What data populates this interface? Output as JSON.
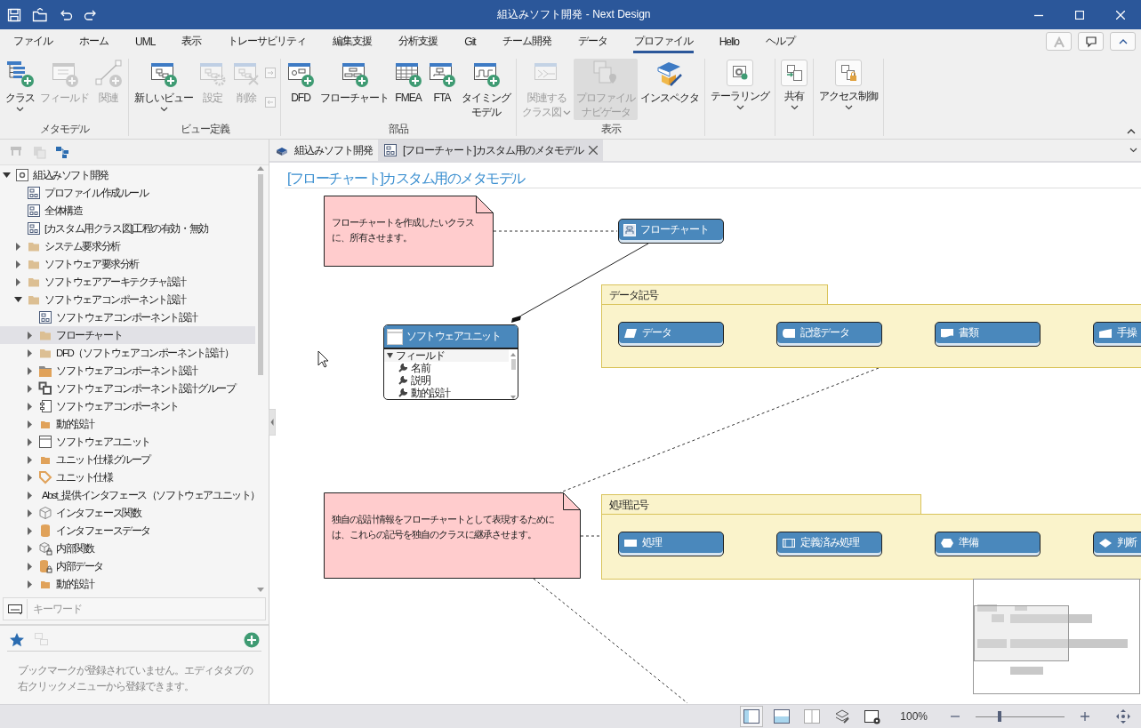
{
  "window": {
    "title": "組込みソフト開発 - Next Design"
  },
  "menu_tabs": [
    {
      "label": "ファイル",
      "selected": false
    },
    {
      "label": "ホーム",
      "selected": false
    },
    {
      "label": "UML",
      "selected": false
    },
    {
      "label": "表示",
      "selected": false
    },
    {
      "label": "トレーサビリティ",
      "selected": false
    },
    {
      "label": "編集支援",
      "selected": false
    },
    {
      "label": "分析支援",
      "selected": false
    },
    {
      "label": "Git",
      "selected": false
    },
    {
      "label": "チーム開発",
      "selected": false
    },
    {
      "label": "データ",
      "selected": false
    },
    {
      "label": "プロファイル",
      "selected": true
    },
    {
      "label": "Hello",
      "selected": false
    },
    {
      "label": "ヘルプ",
      "selected": false
    }
  ],
  "ribbon": {
    "groups": [
      {
        "label": "メタモデル",
        "items": [
          {
            "kind": "large",
            "lines": [
              "クラス"
            ],
            "disabled": false,
            "dropdown": true
          },
          {
            "kind": "large",
            "lines": [
              "フィールド"
            ],
            "disabled": true,
            "dropdown": false
          },
          {
            "kind": "large",
            "lines": [
              "関連"
            ],
            "disabled": true,
            "dropdown": false
          }
        ]
      },
      {
        "label": "ビュー定義",
        "items": [
          {
            "kind": "large",
            "lines": [
              "新しいビュー"
            ],
            "disabled": false,
            "dropdown": true
          },
          {
            "kind": "large",
            "lines": [
              "設定"
            ],
            "disabled": true,
            "dropdown": false
          },
          {
            "kind": "large",
            "lines": [
              "削除"
            ],
            "disabled": true,
            "dropdown": false
          },
          {
            "kind": "small",
            "disabled": true
          },
          {
            "kind": "small",
            "disabled": true
          }
        ]
      },
      {
        "label": "部品",
        "items": [
          {
            "kind": "large",
            "lines": [
              "DFD"
            ],
            "disabled": false,
            "dropdown": false
          },
          {
            "kind": "large",
            "lines": [
              "フローチャート"
            ],
            "disabled": false,
            "dropdown": false
          },
          {
            "kind": "large",
            "lines": [
              "FMEA"
            ],
            "disabled": false,
            "dropdown": false
          },
          {
            "kind": "large",
            "lines": [
              "FTA"
            ],
            "disabled": false,
            "dropdown": false
          },
          {
            "kind": "large",
            "lines": [
              "タイミング",
              "モデル"
            ],
            "disabled": false,
            "dropdown": false
          }
        ]
      },
      {
        "label": "表示",
        "items": [
          {
            "kind": "large",
            "lines": [
              "関連する",
              "クラス図"
            ],
            "disabled": true,
            "dropdown": true,
            "pressed": false
          },
          {
            "kind": "large",
            "lines": [
              "プロファイル",
              "ナビゲータ"
            ],
            "disabled": true,
            "dropdown": false,
            "pressed": true
          },
          {
            "kind": "large",
            "lines": [
              "インスペクタ"
            ],
            "disabled": false,
            "dropdown": false,
            "pressed": false
          }
        ]
      },
      {
        "items": [
          {
            "kind": "boxed",
            "lines": [
              "テーラリング"
            ],
            "disabled": false,
            "dropdown": true
          }
        ]
      },
      {
        "items": [
          {
            "kind": "boxed",
            "lines": [
              "共有"
            ],
            "disabled": false,
            "dropdown": true
          }
        ]
      },
      {
        "items": [
          {
            "kind": "boxed",
            "lines": [
              "アクセス制御"
            ],
            "disabled": false,
            "dropdown": true
          }
        ]
      }
    ]
  },
  "tree_toolbar": [
    {
      "disabled": true
    },
    {
      "disabled": true
    },
    {
      "disabled": false
    }
  ],
  "tree": [
    {
      "kind": "project",
      "label": "組込みソフト開発",
      "expanded": true,
      "selected": false,
      "children": [
        {
          "kind": "diagram",
          "label": "プロファイル作成ルール",
          "selected": false
        },
        {
          "kind": "diagram",
          "label": "全体構造",
          "selected": false
        },
        {
          "kind": "diagram",
          "label": "[カスタム用クラス図]工程の有効・無効",
          "selected": false
        },
        {
          "kind": "package",
          "label": "システム要求分析",
          "expanded": false,
          "selected": false
        },
        {
          "kind": "package",
          "label": "ソフトウェア要求分析",
          "expanded": false,
          "selected": false
        },
        {
          "kind": "package",
          "label": "ソフトウェアアーキテクチャ設計",
          "expanded": false,
          "selected": false
        },
        {
          "kind": "package",
          "label": "ソフトウェアコンポーネント設計",
          "expanded": true,
          "selected": false,
          "children": [
            {
              "kind": "diagram",
              "label": "ソフトウェアコンポーネント設計",
              "selected": false
            },
            {
              "kind": "package",
              "label": "フローチャート",
              "expanded": false,
              "selected": true
            },
            {
              "kind": "package",
              "label": "DFD（ソフトウェアコンポーネント設計）",
              "expanded": false,
              "selected": false
            },
            {
              "kind": "bigfolder",
              "label": "ソフトウェアコンポーネント設計",
              "expanded": false,
              "selected": false
            },
            {
              "kind": "group",
              "label": "ソフトウェアコンポーネント設計グループ",
              "expanded": false,
              "selected": false
            },
            {
              "kind": "component",
              "label": "ソフトウェアコンポーネント",
              "expanded": false,
              "selected": false
            },
            {
              "kind": "folder",
              "label": "動的設計",
              "expanded": false,
              "selected": false
            },
            {
              "kind": "unit",
              "label": "ソフトウェアユニット",
              "expanded": false,
              "selected": false
            },
            {
              "kind": "folder",
              "label": "ユニット仕様グループ",
              "expanded": false,
              "selected": false
            },
            {
              "kind": "tag",
              "label": "ユニット仕様",
              "expanded": false,
              "selected": false
            },
            {
              "kind": "interface",
              "label": "Abst_提供インタフェース（ソフトウェアユニット）",
              "expanded": false,
              "selected": false
            },
            {
              "kind": "cube",
              "label": "インタフェース関数",
              "expanded": false,
              "selected": false
            },
            {
              "kind": "cylinder",
              "label": "インタフェースデータ",
              "expanded": false,
              "selected": false
            },
            {
              "kind": "cube-private",
              "label": "内部関数",
              "expanded": false,
              "selected": false
            },
            {
              "kind": "cylinder-private",
              "label": "内部データ",
              "expanded": false,
              "selected": false
            },
            {
              "kind": "folder",
              "label": "動的設計",
              "expanded": false,
              "selected": false
            }
          ]
        }
      ]
    }
  ],
  "search": {
    "placeholder": "キーワード"
  },
  "bookmarks": {
    "tools": [
      {
        "disabled": false
      },
      {
        "disabled": true
      }
    ],
    "message": "ブックマークが登録されていません。エディタタブの右クリックメニューから登録できます。"
  },
  "editor_tabs": [
    {
      "label": "組込みソフト開発",
      "selected": false,
      "closable": false
    },
    {
      "label": "[フローチャート]カスタム用のメタモデル",
      "selected": true,
      "closable": true
    }
  ],
  "diagram": {
    "title": "[フローチャート]カスタム用のメタモデル",
    "notes": [
      {
        "text": "フローチャートを作成したいクラスに、所有させます。"
      },
      {
        "text": "独自の設計情報をフローチャートとして表現するためには、これらの記号を独自のクラスに継承させます。"
      }
    ],
    "classes": [
      {
        "kind": "flowchart",
        "label": "フローチャート"
      },
      {
        "kind": "unit",
        "label": "ソフトウェアユニット",
        "compartment": {
          "label": "フィールド",
          "expanded": true,
          "fields": [
            "名前",
            "説明",
            "動的設計"
          ]
        }
      }
    ],
    "groups": [
      {
        "label": "データ記号",
        "items": [
          {
            "kind": "data",
            "label": "データ"
          },
          {
            "kind": "stored-data",
            "label": "記憶データ"
          },
          {
            "kind": "document",
            "label": "書類"
          },
          {
            "kind": "manual-input",
            "label": "手操"
          }
        ]
      },
      {
        "label": "処理記号",
        "items": [
          {
            "kind": "process",
            "label": "処理"
          },
          {
            "kind": "predefined",
            "label": "定義済み処理"
          },
          {
            "kind": "preparation",
            "label": "準備"
          },
          {
            "kind": "decision",
            "label": "判断"
          }
        ]
      }
    ]
  },
  "status_bar": {
    "view_modes": [
      {
        "selected": true
      },
      {
        "selected": false
      },
      {
        "selected": false
      }
    ],
    "zoom": "100%",
    "zoom_slider": {
      "level": 0.27
    }
  }
}
